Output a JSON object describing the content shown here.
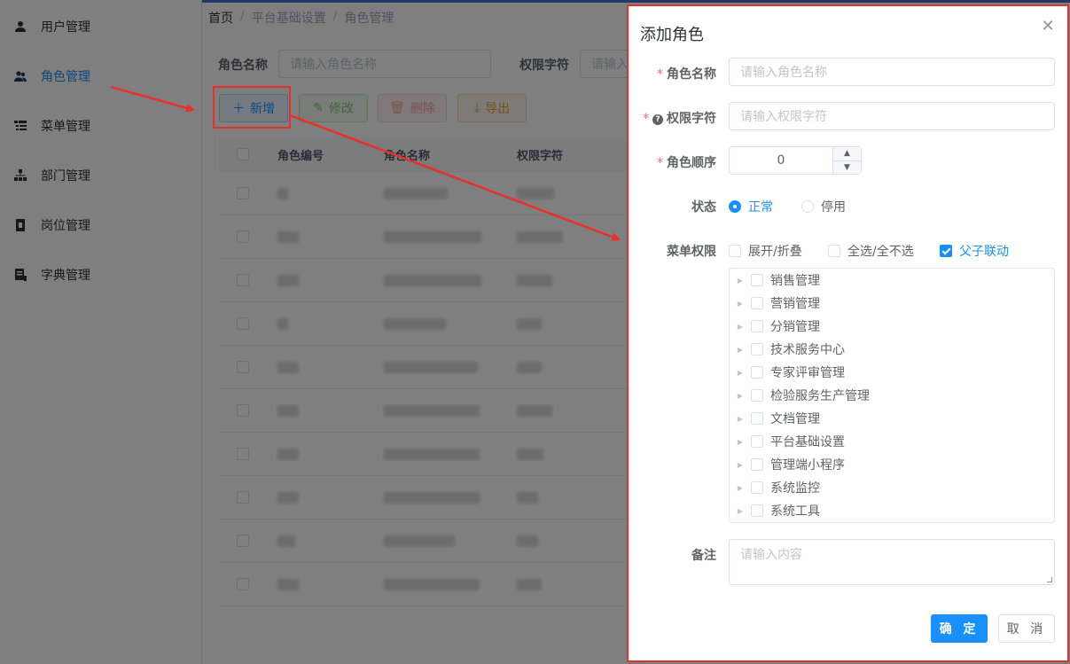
{
  "sidebar": {
    "items": [
      {
        "label": "用户管理",
        "icon": "user-icon"
      },
      {
        "label": "角色管理",
        "icon": "users-icon",
        "active": true
      },
      {
        "label": "菜单管理",
        "icon": "tree-table-icon"
      },
      {
        "label": "部门管理",
        "icon": "org-tree-icon"
      },
      {
        "label": "岗位管理",
        "icon": "post-icon"
      },
      {
        "label": "字典管理",
        "icon": "dict-icon"
      }
    ]
  },
  "breadcrumb": [
    "首页",
    "平台基础设置",
    "角色管理"
  ],
  "search": {
    "role_name_label": "角色名称",
    "role_name_placeholder": "请输入角色名称",
    "perm_label": "权限字符",
    "perm_placeholder": "请输入"
  },
  "toolbar": {
    "add": "新增",
    "edit": "修改",
    "delete": "删除",
    "export": "导出"
  },
  "table": {
    "headers": [
      "角色编号",
      "角色名称",
      "权限字符"
    ],
    "row_count": 10
  },
  "dialog": {
    "title": "添加角色",
    "role_name_label": "角色名称",
    "role_name_placeholder": "请输入角色名称",
    "perm_label": "权限字符",
    "perm_placeholder": "请输入权限字符",
    "order_label": "角色顺序",
    "order_value": "0",
    "status_label": "状态",
    "status_normal": "正常",
    "status_disabled": "停用",
    "menu_perm_label": "菜单权限",
    "expand_label": "展开/折叠",
    "select_all_label": "全选/全不选",
    "link_label": "父子联动",
    "menu_tree": [
      "销售管理",
      "营销管理",
      "分销管理",
      "技术服务中心",
      "专家评审管理",
      "检验服务生产管理",
      "文档管理",
      "平台基础设置",
      "管理端小程序",
      "系统监控",
      "系统工具"
    ],
    "remark_label": "备注",
    "remark_placeholder": "请输入内容",
    "ok": "确 定",
    "cancel": "取 消"
  },
  "colors": {
    "primary": "#1890ff",
    "annotation": "#e8302b"
  }
}
